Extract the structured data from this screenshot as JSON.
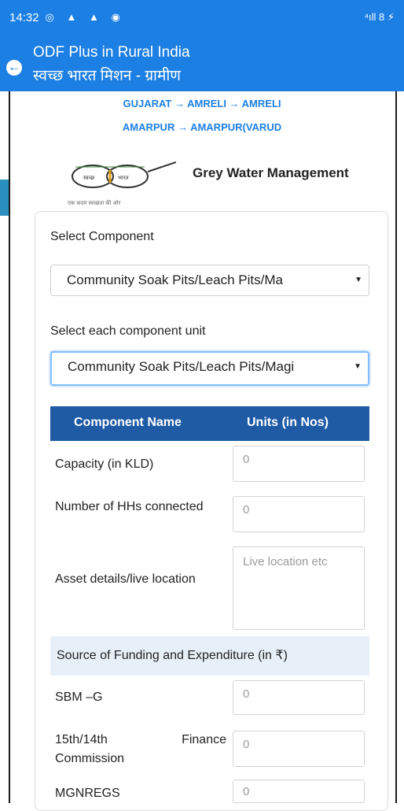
{
  "status_bar": {
    "time": "14:32",
    "left_icons": "◎ ▲ ▲ ◉",
    "right_icons": "⁴ıll 8 ⚡"
  },
  "app_bar": {
    "title_en": "ODF Plus in Rural India",
    "title_hi": "स्वच्छ भारत मिशन - ग्रामीण"
  },
  "breadcrumb": {
    "line1": "GUJARAT → AMRELI → AMRELI",
    "line2": "AMARPUR → AMARPUR(VARUD"
  },
  "logo": {
    "left_text": "स्वच्छ",
    "right_text": "भारत",
    "tagline": "एक कदम स्वच्छता की ओर"
  },
  "section_title": "Grey Water Management",
  "form": {
    "select_component_label": "Select Component",
    "select_component_value": "Community Soak Pits/Leach Pits/Ma",
    "select_unit_label": "Select each component unit",
    "select_unit_value": "Community Soak Pits/Leach Pits/Magi"
  },
  "table": {
    "header_name": "Component Name",
    "header_units": "Units (in Nos)",
    "rows": [
      {
        "label": "Capacity (in KLD)",
        "placeholder": "0"
      },
      {
        "label": "Number of HHs connected",
        "placeholder": "0"
      },
      {
        "label": "Asset details/live location",
        "placeholder": "Live location etc"
      }
    ]
  },
  "funding": {
    "heading": "Source of Funding and Expenditure (in ₹)",
    "rows": [
      {
        "label": "SBM –G",
        "placeholder": "0"
      },
      {
        "label": "15th/14th Finance Commission",
        "placeholder": "0"
      },
      {
        "label": "MGNREGS",
        "placeholder": "0"
      }
    ]
  },
  "colors": {
    "primary": "#1c7fe3",
    "table_header": "#1f5aa5",
    "funding_bg": "#e7f0f9"
  }
}
